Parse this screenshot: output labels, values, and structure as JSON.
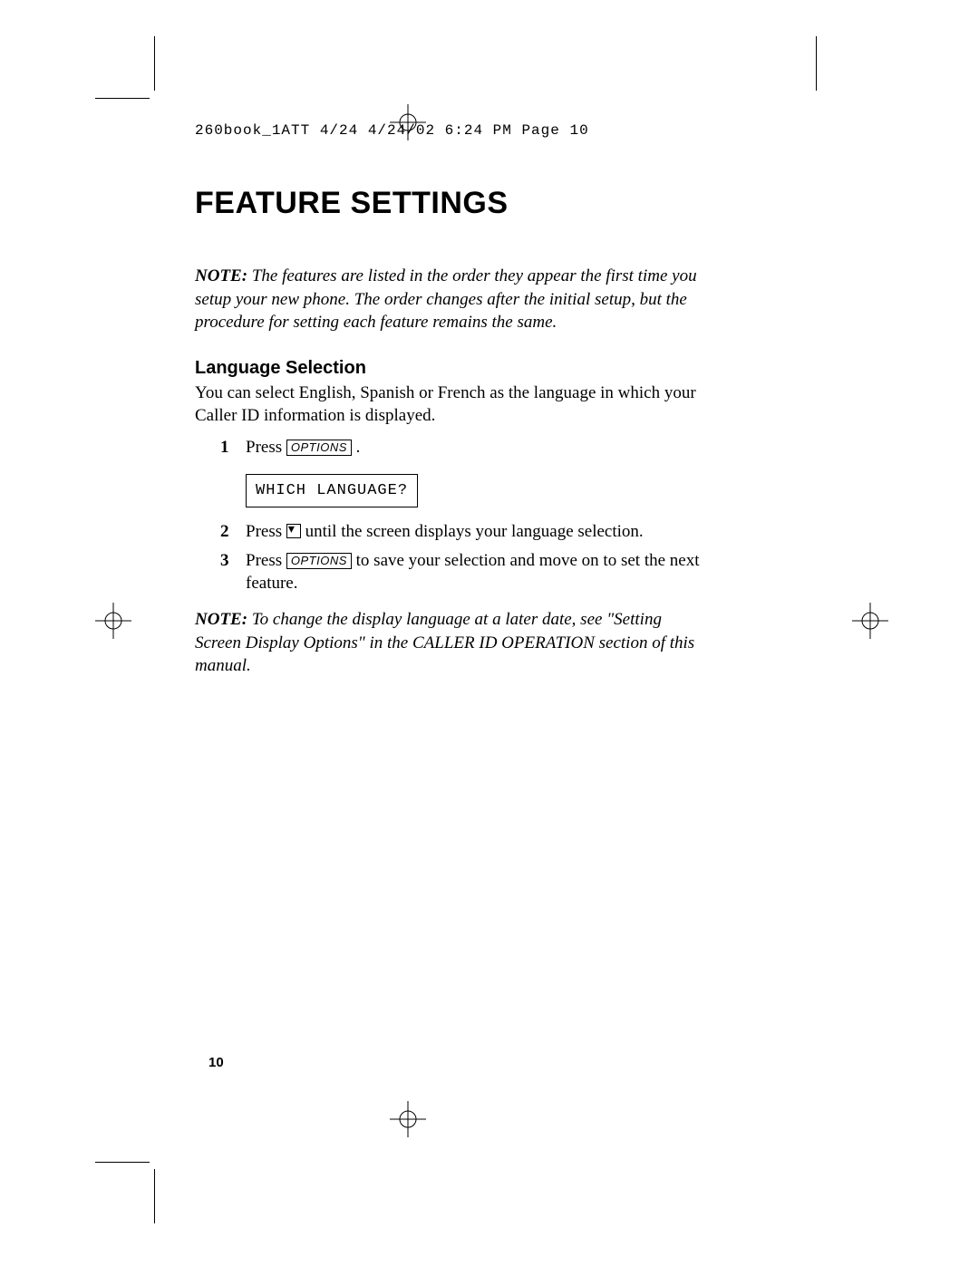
{
  "runhead": "260book_1ATT 4/24  4/24/02  6:24 PM  Page 10",
  "title": "FEATURE SETTINGS",
  "note1_lead": "NOTE:",
  "note1_body": "The features are listed in the order they appear the first time you setup your new phone. The order changes after the initial setup, but the procedure for setting each feature remains the same.",
  "subhead": "Language Selection",
  "intro": "You can select English, Spanish or French as the language in which your Caller ID information is displayed.",
  "options_key": "OPTIONS",
  "lcd_text": "WHICH LANGUAGE?",
  "steps": {
    "s1": {
      "num": "1",
      "pre": "Press ",
      "post": "."
    },
    "s2": {
      "num": "2",
      "pre": "Press ",
      "post": " until the screen displays your language selection."
    },
    "s3": {
      "num": "3",
      "pre": "Press ",
      "post": " to save your selection and move on to set the next feature."
    }
  },
  "note2_lead": "NOTE:",
  "note2_body": "To change the display language at a later date, see \"Setting Screen Display Options\" in the CALLER ID OPERATION section of this manual.",
  "page_number": "10"
}
